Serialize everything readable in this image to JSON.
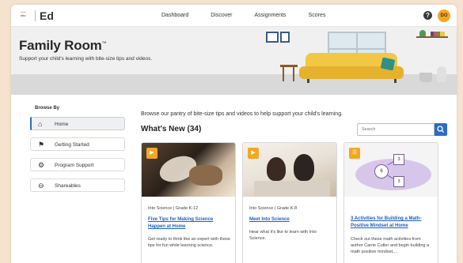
{
  "nav": {
    "logo_text": "into",
    "brand": "Ed",
    "links": [
      "Dashboard",
      "Discover",
      "Assignments",
      "Scores"
    ],
    "help_label": "?",
    "avatar_initials": "DO"
  },
  "hero": {
    "title": "Family Room",
    "trademark": "™",
    "subtitle": "Support your child's learning with bite-size tips and videos."
  },
  "sidebar": {
    "heading": "Browse By",
    "items": [
      {
        "label": "Home",
        "icon": "house-icon",
        "active": true
      },
      {
        "label": "Getting Started",
        "icon": "flag-icon",
        "active": false
      },
      {
        "label": "Program Support",
        "icon": "cog-icon",
        "active": false
      },
      {
        "label": "Shareables",
        "icon": "share-icon",
        "active": false
      }
    ]
  },
  "main": {
    "intro": "Browse our pantry of bite-size tips and videos to help support your child's learning.",
    "section_title": "What's New (34)",
    "search_placeholder": "Search"
  },
  "cards": [
    {
      "meta": "Into Science  |  Grade K-12",
      "title": "Five Tips for Making Science Happen at Home",
      "desc": "Get ready to think like an expert with these tips for fun while learning science."
    },
    {
      "meta": "Into Science  |  Grade K-8",
      "title": "Meet Into Science",
      "desc": "Hear what it's like to learn with Into Science."
    },
    {
      "meta": "",
      "title": "3 Activities for Building a Math-Positive Mindset at Home",
      "desc": "Check out these math activities from author Carrie Cutler and begin building a math positive mindset,...",
      "diagram": {
        "center": "6",
        "top": "3",
        "bottom": "3"
      }
    }
  ],
  "colors": {
    "accent": "#2b6cc4",
    "badge": "#f4a623",
    "page_bg": "#f5e2cf"
  }
}
